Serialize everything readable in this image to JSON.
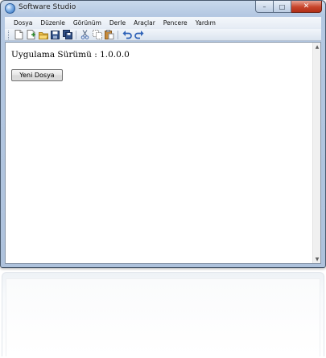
{
  "window": {
    "title": "Software Studio",
    "minimize_glyph": "–",
    "maximize_glyph": "□",
    "close_glyph": "✕"
  },
  "menu": {
    "items": [
      "Dosya",
      "Düzenle",
      "Görünüm",
      "Derle",
      "Araçlar",
      "Pencere",
      "Yardım"
    ]
  },
  "toolbar": {
    "icons": [
      "new-file-icon",
      "add-file-icon",
      "open-folder-icon",
      "save-icon",
      "save-all-icon",
      "cut-icon",
      "copy-icon",
      "paste-icon",
      "undo-icon",
      "redo-icon"
    ]
  },
  "content": {
    "version_label": "Uygulama Sürümü : 1.0.0.0",
    "new_file_button": "Yeni Dosya"
  },
  "scrollbar": {
    "up_glyph": "▲",
    "down_glyph": "▼"
  },
  "colors": {
    "frame": "#b4c8e2",
    "close_button": "#c7442b",
    "accent_blue": "#2b6ab8"
  }
}
